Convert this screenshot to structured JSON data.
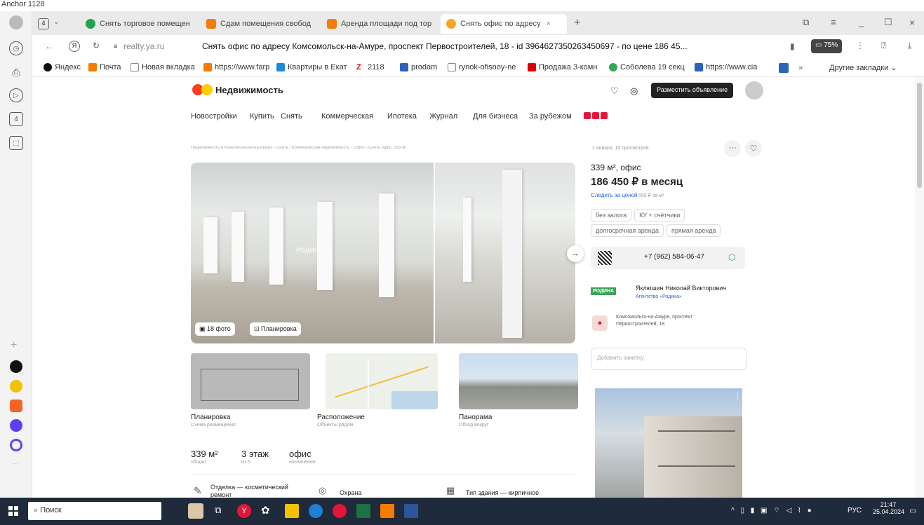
{
  "top_label": "Anchor 1128",
  "tabs": [
    {
      "label": "Снять торговое помещен",
      "color": "#1fa34a"
    },
    {
      "label": "Сдам помещения свобод",
      "color": "#f57c00"
    },
    {
      "label": "Аренда площади под тор",
      "color": "#f57c00"
    },
    {
      "label": "Снять офис по адресу",
      "color": "#f5a623"
    }
  ],
  "tab_counter": "4",
  "address": {
    "domain": "realty.ya.ru",
    "title": "Снять офис по адресу Комсомольск-на-Амуре, проспект Первостроителей, 18 - id 3964627350263450697 - по цене 186 45...",
    "zoom": "75%"
  },
  "bookmarks": [
    {
      "label": "Яндекс",
      "color": "#111"
    },
    {
      "label": "Почта",
      "color": "#f57c00"
    },
    {
      "label": "Новая вкладка",
      "color": "#888"
    },
    {
      "label": "https://www.farp",
      "color": "#f57c00"
    },
    {
      "label": "Квартиры в Екат",
      "color": "#1f8ad2"
    },
    {
      "label": "2118",
      "color": "#d00"
    },
    {
      "label": "prodam",
      "color": "#2b63b5"
    },
    {
      "label": "rynok-ofisnoy-ne",
      "color": "#888"
    },
    {
      "label": "Продажа 3-комн",
      "color": "#d00"
    },
    {
      "label": "Соболева 19 секц",
      "color": "#34a853"
    },
    {
      "label": "https://www.cia",
      "color": "#2b63b5"
    }
  ],
  "bookmarks_more": "Другие закладки",
  "site": {
    "logo": "Недвижимость",
    "post_button": "Разместить объявление",
    "nav": [
      "Новостройки",
      "Купить",
      "Снять",
      "Коммерческая",
      "Ипотека",
      "Журнал",
      "Для бизнеса",
      "За рубежом"
    ],
    "breadcrumb": "Недвижимость в Комсомольске-на-Амуре › Снять › Коммерческая недвижимость › Офис › Снять офис, 339 м²",
    "photos_btn": "18 фото",
    "plan_btn": "Планировка",
    "watermark": "РОДИНА"
  },
  "thumbs": [
    {
      "title": "Планировка",
      "sub": "Схема размещения"
    },
    {
      "title": "Расположение",
      "sub": "Объекты рядом"
    },
    {
      "title": "Панорама",
      "sub": "Обзор вокруг"
    }
  ],
  "facts": [
    {
      "value": "339 м²",
      "sub": "общая"
    },
    {
      "value": "3 этаж",
      "sub": "из 5"
    },
    {
      "value": "офис",
      "sub": "назначение"
    }
  ],
  "features": [
    "Отделка — косметический ремонт",
    "Охрана",
    "Тип здания — кирпичное"
  ],
  "offer": {
    "date": "1 января, 10 просмотров",
    "area": "339 м², офис",
    "price": "186 450 ₽ в месяц",
    "follow": "Следить за ценой",
    "per_m": "550 ₽ за м²",
    "tags": [
      "без залога",
      "КУ + счётчики",
      "долгосрочная аренда",
      "прямая аренда"
    ],
    "phone": "+7 (962) 584-06-47",
    "agent": "Яклюшин Николай Викторович",
    "agency": "Агентство «Родина»",
    "agency_badge": "РОДИНА",
    "address": "Комсомольск-на-Амуре, проспект Первостроителей, 18",
    "note_placeholder": "Добавить заметку"
  },
  "taskbar": {
    "search": "Поиск",
    "lang": "РУС",
    "time": "21:47",
    "date": "25.04.2024"
  }
}
